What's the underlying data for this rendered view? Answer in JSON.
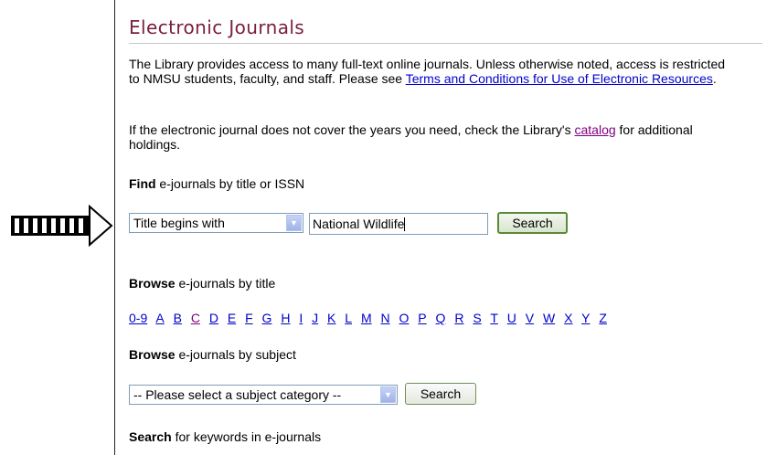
{
  "page_title": "Electronic Journals",
  "intro": {
    "text": "The Library provides access to many full-text online journals. Unless otherwise noted, access is restricted to NMSU students, faculty, and staff. Please see ",
    "link": "Terms and Conditions for Use of Electronic Resources",
    "end": "."
  },
  "coverage": {
    "text": "If the electronic journal does not cover the years you need, check the Library's ",
    "link": "catalog",
    "end": " for additional holdings."
  },
  "find": {
    "label_bold": "Find",
    "label_rest": " e-journals by title or ISSN",
    "select_value": "Title begins with",
    "input_value": "National Wildlife",
    "button": "Search"
  },
  "browse_title": {
    "label_bold": "Browse",
    "label_rest": " e-journals by title",
    "letters": [
      "0-9",
      "A",
      "B",
      "C",
      "D",
      "E",
      "F",
      "G",
      "H",
      "I",
      "J",
      "K",
      "L",
      "M",
      "N",
      "O",
      "P",
      "Q",
      "R",
      "S",
      "T",
      "U",
      "V",
      "W",
      "X",
      "Y",
      "Z"
    ]
  },
  "browse_subject": {
    "label_bold": "Browse",
    "label_rest": " e-journals by subject",
    "select_value": "-- Please select a subject category --",
    "button": "Search"
  },
  "keywords": {
    "label_bold": "Search",
    "label_rest": " for keywords in e-journals"
  }
}
